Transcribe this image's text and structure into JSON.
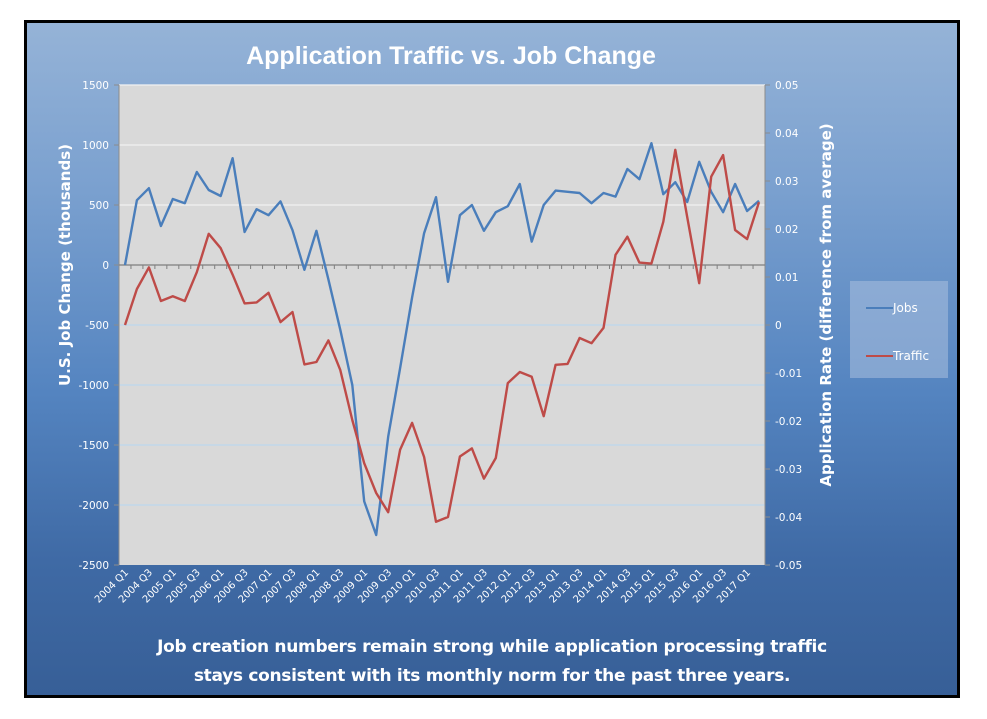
{
  "chart_data": {
    "type": "line",
    "title": "Application Traffic vs. Job Change",
    "xlabel": "",
    "ylabel": "U.S. Job Change (thousands)",
    "y2label": "Application Rate (difference from average)",
    "ylim": [
      -2500,
      1500
    ],
    "y2lim": [
      -0.05,
      0.05
    ],
    "yticks": [
      "1500",
      "1000",
      "500",
      "0",
      "-500",
      "-1000",
      "-1500",
      "-2000",
      "-2500"
    ],
    "y2ticks": [
      "0.05",
      "0.04",
      "0.03",
      "0.02",
      "0.01",
      "0",
      "-0.01",
      "-0.02",
      "-0.03",
      "-0.04",
      "-0.05"
    ],
    "grid": true,
    "legend_position": "right",
    "x": [
      "2004 Q1",
      "2004 Q2",
      "2004 Q3",
      "2004 Q4",
      "2005 Q1",
      "2005 Q2",
      "2005 Q3",
      "2005 Q4",
      "2006 Q1",
      "2006 Q2",
      "2006 Q3",
      "2006 Q4",
      "2007 Q1",
      "2007 Q2",
      "2007 Q3",
      "2007 Q4",
      "2008 Q1",
      "2008 Q2",
      "2008 Q3",
      "2008 Q4",
      "2009 Q1",
      "2009 Q2",
      "2009 Q3",
      "2009 Q4",
      "2010 Q1",
      "2010 Q2",
      "2010 Q3",
      "2010 Q4",
      "2011 Q1",
      "2011 Q2",
      "2011 Q3",
      "2011 Q4",
      "2012 Q1",
      "2012 Q2",
      "2012 Q3",
      "2012 Q4",
      "2013 Q1",
      "2013 Q2",
      "2013 Q3",
      "2013 Q4",
      "2014 Q1",
      "2014 Q2",
      "2014 Q3",
      "2014 Q4",
      "2015 Q1",
      "2015 Q2",
      "2015 Q3",
      "2015 Q4",
      "2016 Q1",
      "2016 Q2",
      "2016 Q3",
      "2016 Q4",
      "2017 Q1",
      "2017 Q2"
    ],
    "xtick_labels": [
      "2004 Q1",
      "2004 Q3",
      "2005 Q1",
      "2005 Q3",
      "2006 Q1",
      "2006 Q3",
      "2007 Q1",
      "2007 Q3",
      "2008 Q1",
      "2008 Q3",
      "2009 Q1",
      "2009 Q3",
      "2010 Q1",
      "2010 Q3",
      "2011 Q1",
      "2011 Q3",
      "2012 Q1",
      "2012 Q3",
      "2013 Q1",
      "2013 Q3",
      "2014 Q1",
      "2014 Q3",
      "2015 Q1",
      "2015 Q3",
      "2016 Q1",
      "2016 Q3",
      "2017 Q1"
    ],
    "series": [
      {
        "name": "Jobs",
        "axis": "left",
        "color": "#4a7ebb",
        "values": [
          0,
          540,
          640,
          325,
          550,
          515,
          775,
          625,
          575,
          890,
          275,
          465,
          415,
          530,
          290,
          -40,
          285,
          -120,
          -540,
          -1000,
          -1970,
          -2250,
          -1430,
          -860,
          -270,
          265,
          565,
          -140,
          415,
          500,
          285,
          440,
          490,
          675,
          195,
          500,
          620,
          610,
          600,
          515,
          600,
          570,
          800,
          715,
          1015,
          590,
          690,
          525,
          860,
          610,
          440,
          675,
          450,
          535
        ]
      },
      {
        "name": "Traffic",
        "axis": "right",
        "color": "#be4b48",
        "values": [
          0.0,
          0.0075,
          0.012,
          0.005,
          0.006,
          0.005,
          0.011,
          0.019,
          0.016,
          0.0105,
          0.0045,
          0.0047,
          0.0067,
          0.0006,
          0.0027,
          -0.0082,
          -0.0077,
          -0.0032,
          -0.0094,
          -0.0198,
          -0.0288,
          -0.035,
          -0.039,
          -0.026,
          -0.0204,
          -0.0275,
          -0.041,
          -0.04,
          -0.0274,
          -0.0257,
          -0.032,
          -0.0277,
          -0.0121,
          -0.0098,
          -0.0108,
          -0.019,
          -0.0083,
          -0.0081,
          -0.0027,
          -0.0038,
          -0.0006,
          0.0146,
          0.0184,
          0.013,
          0.0128,
          0.0215,
          0.0365,
          0.0225,
          0.0087,
          0.0309,
          0.0354,
          0.0198,
          0.0179,
          0.0256
        ]
      }
    ]
  },
  "footer": {
    "line1": "Job creation numbers remain strong while application processing traffic",
    "line2": "stays consistent with its monthly norm for the past three years."
  }
}
